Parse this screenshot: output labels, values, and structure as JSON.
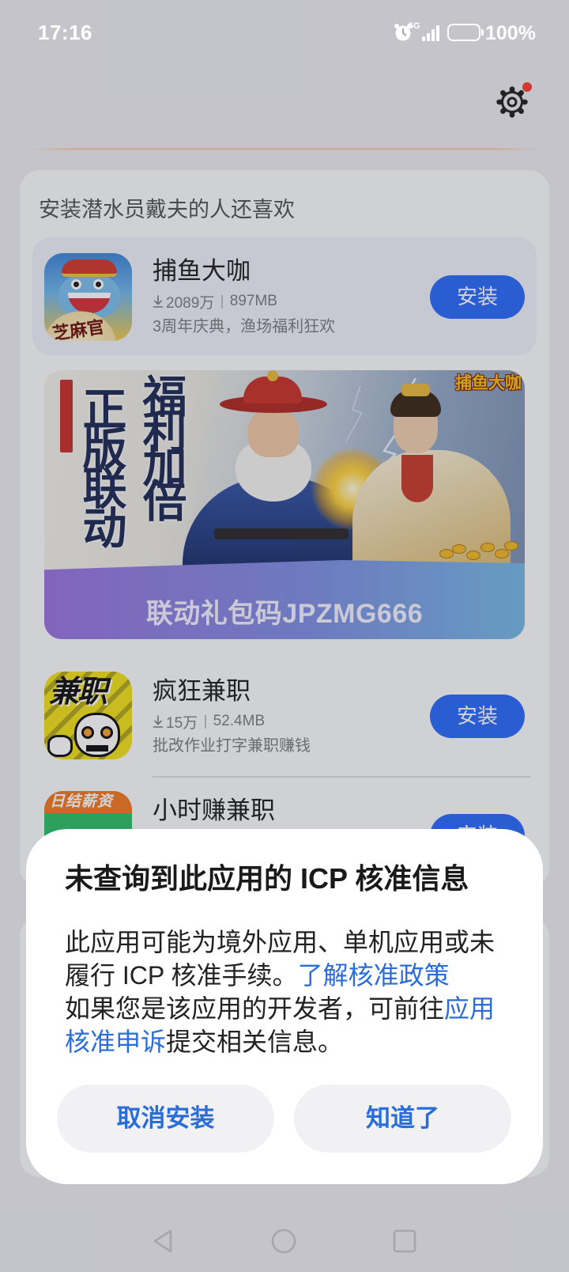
{
  "status_bar": {
    "time": "17:16",
    "network": "5G",
    "battery": "100%",
    "icons": [
      "alarm-icon",
      "signal-icon",
      "battery-icon"
    ]
  },
  "header": {
    "settings_icon": "gear-icon",
    "notification_dot": true
  },
  "recommend": {
    "title": "安装潜水员戴夫的人还喜欢",
    "apps": [
      {
        "name": "捕鱼大咖",
        "downloads": "2089万",
        "size": "897MB",
        "desc": "3周年庆典，渔场福利狂欢",
        "button": "安装",
        "icon_text": "芝麻官",
        "icon": "shark-app-icon"
      },
      {
        "name": "疯狂兼职",
        "downloads": "15万",
        "size": "52.4MB",
        "desc": "批改作业打字兼职赚钱",
        "button": "安装",
        "icon_text": "兼职",
        "icon": "job-app-icon"
      },
      {
        "name": "小时赚兼职",
        "button": "安装",
        "icon_text": "日结薪资",
        "icon": "daily-pay-app-icon"
      }
    ],
    "banner": {
      "slogan_left": "正版联动",
      "slogan_right": "福利加倍",
      "logo": "捕鱼大咖",
      "code_text": "联动礼包码JPZMG666"
    }
  },
  "dialog": {
    "title": "未查询到此应用的 ICP 核准信息",
    "line1": "此应用可能为境外应用、单机应用或未",
    "line2": "履行 ICP 核准手续。",
    "policy_link": "了解核准政策",
    "line3": "如果您是该应用的开发者，可前往",
    "appeal_link_start": "应用",
    "appeal_link_end": "核准申诉",
    "line4": "提交相关信息。",
    "cancel_button": "取消安装",
    "ok_button": "知道了"
  },
  "nav_bar": {
    "icons": [
      "back-icon",
      "home-icon",
      "recents-icon"
    ]
  },
  "colors": {
    "accent": "#2b6afa",
    "link": "#2a6dd9",
    "dialog_background": "#ffffff",
    "notification_dot": "#ff3b30"
  }
}
